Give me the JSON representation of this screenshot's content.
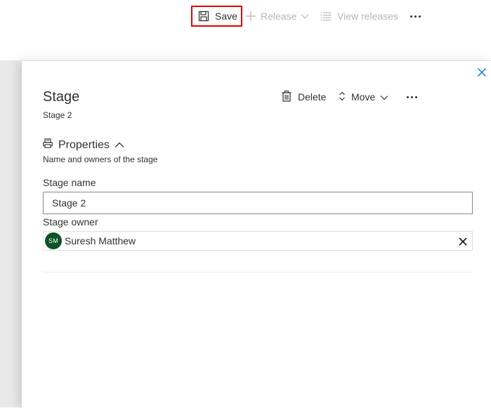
{
  "toolbar": {
    "save_label": "Save",
    "release_label": "Release",
    "view_releases_label": "View releases",
    "more_icon": "more-icon"
  },
  "panel": {
    "title": "Stage",
    "subtitle": "Stage 2",
    "delete_label": "Delete",
    "move_label": "Move",
    "section": {
      "title": "Properties",
      "description": "Name and owners of the stage",
      "expanded": true
    },
    "fields": {
      "name_label": "Stage name",
      "name_value": "Stage 2",
      "owner_label": "Stage owner",
      "owner": {
        "initials": "SM",
        "name": "Suresh Matthew",
        "avatar_color": "#0b5227"
      }
    }
  },
  "colors": {
    "highlight_border": "#e00000",
    "disabled_text": "#b8b6b4",
    "close_icon": "#0078d4"
  }
}
